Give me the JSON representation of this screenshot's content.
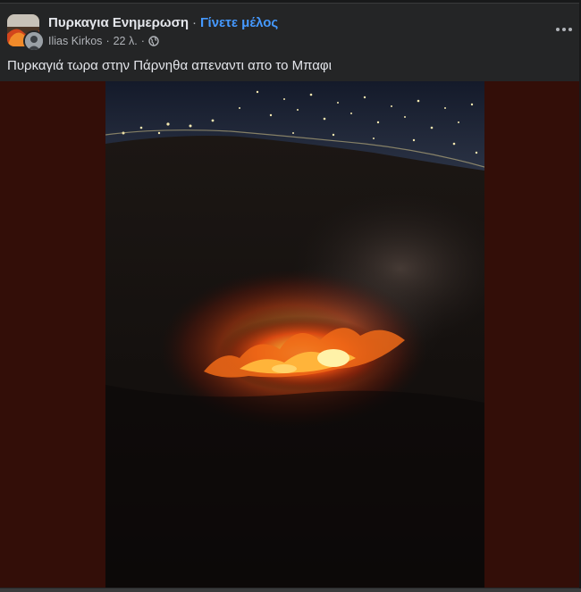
{
  "post": {
    "group_name": "Πυρκαγια Ενημερωση",
    "separator": "·",
    "join_label": "Γίνετε μέλος",
    "author": "Ilias Kirkos",
    "time": "22 λ.",
    "audience_icon": "globe-icon",
    "more_icon": "more-options-icon",
    "caption": "Πυρκαγιά τωρα στην Πάρνηθα απεναντι απο το Μπαφι"
  },
  "colors": {
    "background": "#242526",
    "link": "#4599ff",
    "media_backdrop": "#330e08"
  }
}
